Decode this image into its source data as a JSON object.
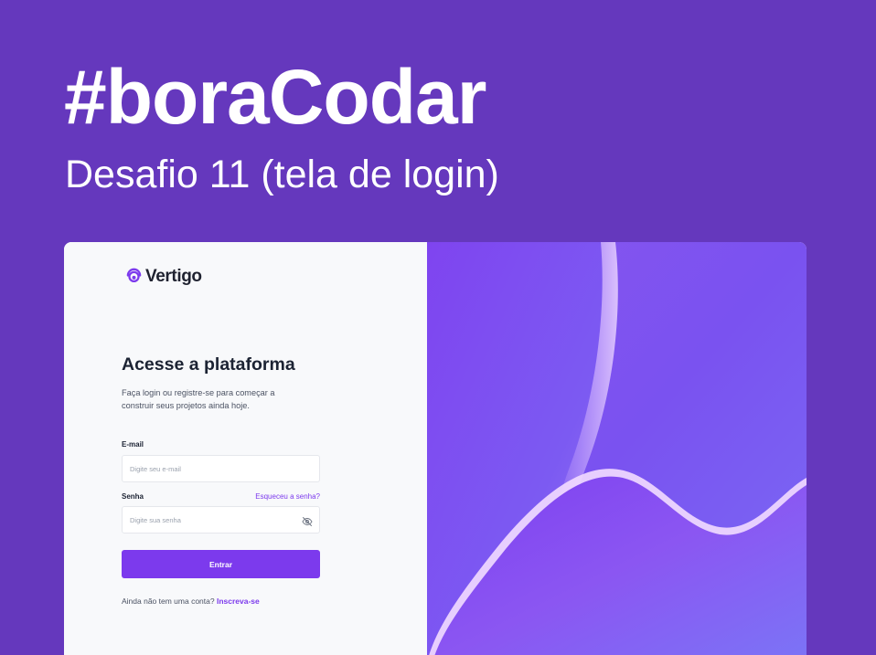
{
  "hero": {
    "title": "#boraCodar",
    "subtitle": "Desafio 11 (tela de login)"
  },
  "colors": {
    "background": "#6538bd",
    "accent": "#7c3aed",
    "card": "#f8f9fb",
    "text_dark": "#1c2333"
  },
  "logo": {
    "icon": "vertigo-logo-icon",
    "text": "Vertigo"
  },
  "form": {
    "title": "Acesse a plataforma",
    "description": "Faça login ou registre-se para começar a construir seus projetos ainda hoje.",
    "email": {
      "label": "E-mail",
      "placeholder": "Digite seu e-mail",
      "value": ""
    },
    "password": {
      "label": "Senha",
      "forgot_link": "Esqueceu a senha?",
      "placeholder": "Digite sua senha",
      "value": "",
      "toggle_icon": "eye-off-icon"
    },
    "submit_label": "Entrar",
    "signup_prompt": "Ainda não tem uma conta?",
    "signup_link": "Inscreva-se"
  }
}
